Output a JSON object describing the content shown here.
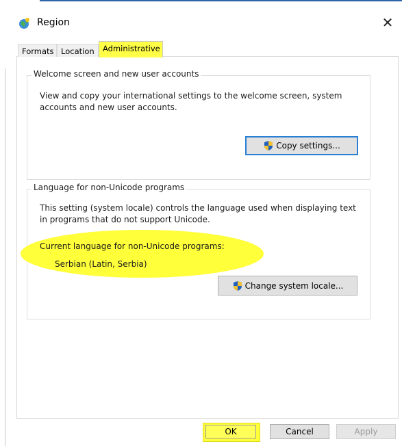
{
  "window": {
    "title": "Region",
    "close_glyph": "✕"
  },
  "tabs": [
    {
      "label": "Formats",
      "active": false
    },
    {
      "label": "Location",
      "active": false
    },
    {
      "label": "Administrative",
      "active": true
    }
  ],
  "welcome_group": {
    "legend": "Welcome screen and new user accounts",
    "description": "View and copy your international settings to the welcome screen, system accounts and new user accounts.",
    "copy_button_label": "Copy settings...",
    "copy_button_icon": "uac-shield-icon"
  },
  "nonunicode_group": {
    "legend": "Language for non-Unicode programs",
    "description": "This setting (system locale) controls the language used when displaying text in programs that do not support Unicode.",
    "current_label": "Current language for non-Unicode programs:",
    "current_value": "Serbian (Latin, Serbia)",
    "change_button_label": "Change system locale...",
    "change_button_icon": "uac-shield-icon"
  },
  "footer": {
    "ok_label": "OK",
    "cancel_label": "Cancel",
    "apply_label": "Apply"
  },
  "colors": {
    "highlight": "#ffff3a",
    "focus_border": "#2a7fd4",
    "button_face": "#e1e1e1"
  }
}
